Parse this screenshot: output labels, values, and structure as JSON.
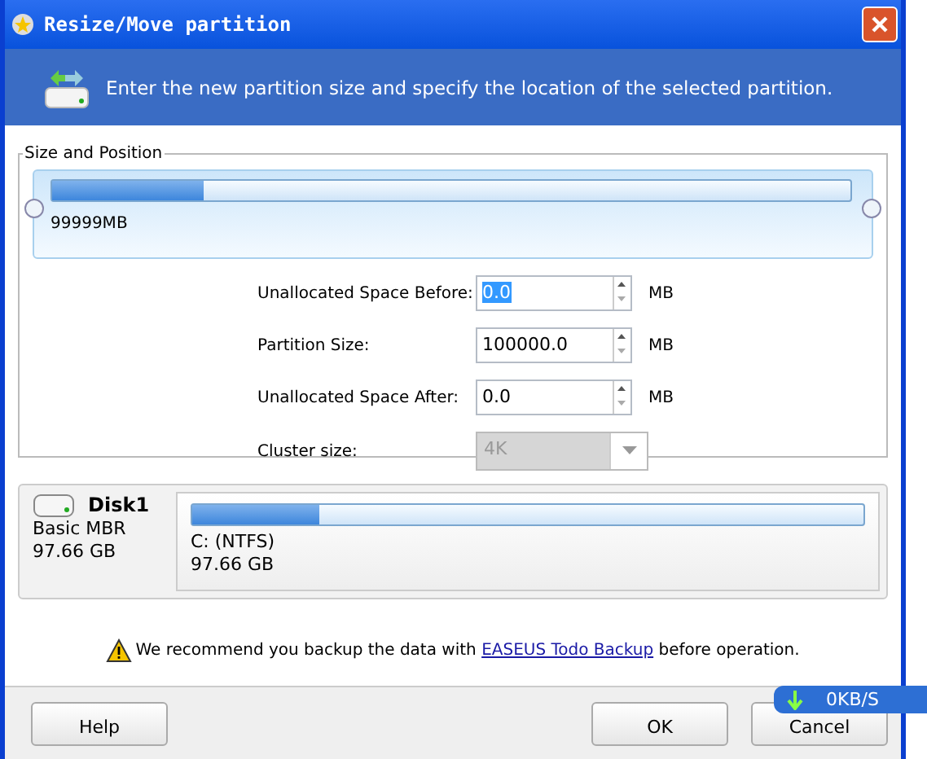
{
  "window": {
    "title": "Resize/Move partition"
  },
  "header": {
    "text": "Enter the new partition size and specify the location of the selected partition."
  },
  "size_and_position": {
    "legend": "Size and Position",
    "level": 0.19,
    "size_label": "99999MB"
  },
  "fields": [
    {
      "kind": "spin",
      "label": "Unallocated Space Before:",
      "value": "0.0",
      "unit": "MB",
      "selected": true
    },
    {
      "kind": "spin",
      "label": "Partition Size:",
      "value": "100000.0",
      "unit": "MB",
      "selected": false
    },
    {
      "kind": "spin",
      "label": "Unallocated Space After:",
      "value": "0.0",
      "unit": "MB",
      "selected": false
    },
    {
      "kind": "dropdown",
      "label": "Cluster size:",
      "value": "4K",
      "disabled": true
    }
  ],
  "disk": {
    "name": "Disk1",
    "type": "Basic MBR",
    "size": "97.66 GB",
    "partition": {
      "label": "C: (NTFS)",
      "size": "97.66 GB",
      "level": 0.19
    }
  },
  "notice": {
    "before": "We recommend you backup the data with",
    "link": "EASEUS Todo Backup",
    "after": "before operation."
  },
  "buttons": [
    {
      "label": "Help"
    },
    {
      "label": "OK"
    },
    {
      "label": "Cancel"
    }
  ],
  "speed_widget": {
    "text": "0KB/S"
  }
}
